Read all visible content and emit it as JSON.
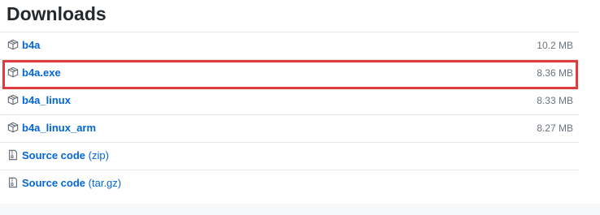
{
  "heading": "Downloads",
  "assets": [
    {
      "name": "b4a",
      "size": "10.2 MB",
      "icon": "package-icon"
    },
    {
      "name": "b4a.exe",
      "size": "8.36 MB",
      "icon": "package-icon"
    },
    {
      "name": "b4a_linux",
      "size": "8.33 MB",
      "icon": "package-icon"
    },
    {
      "name": "b4a_linux_arm",
      "size": "8.27 MB",
      "icon": "package-icon"
    },
    {
      "name": "Source code",
      "suffix": "(zip)",
      "icon": "file-zip-icon"
    },
    {
      "name": "Source code",
      "suffix": "(tar.gz)",
      "icon": "file-zip-icon"
    }
  ],
  "colors": {
    "link": "#0366d6",
    "highlight": "#e23b3f",
    "muted": "#6a737d"
  }
}
